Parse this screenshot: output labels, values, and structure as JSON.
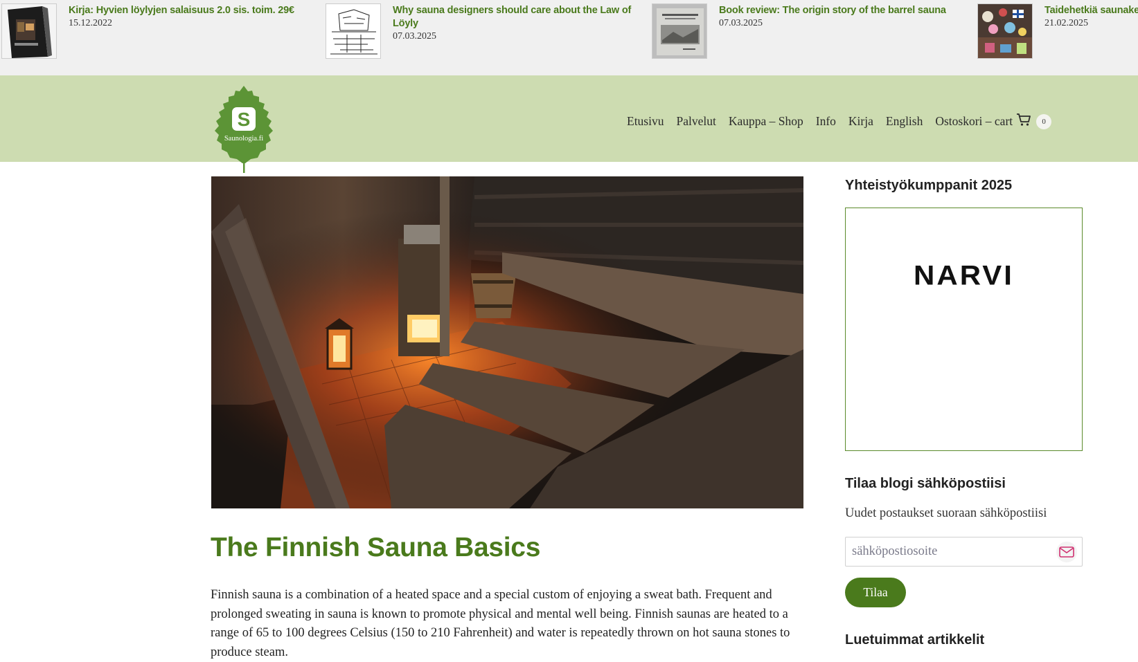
{
  "ticker": [
    {
      "title": "Kirja: Hyvien löylyjen salaisuus 2.0 sis. toim. 29€",
      "date": "15.12.2022",
      "thumb": "book-cover-thumbnail"
    },
    {
      "title": "Why sauna designers should care about the Law of Löyly",
      "date": "07.03.2025",
      "thumb": "sketch-drawing-thumbnail"
    },
    {
      "title": "Book review: The origin story of the barrel sauna",
      "date": "07.03.2025",
      "thumb": "book-cover-thumbnail"
    },
    {
      "title": "Taidehetkiä saunakeskustelu",
      "date": "21.02.2025",
      "thumb": "colorful-art-thumbnail"
    }
  ],
  "header": {
    "logo_letter": "S",
    "logo_text": "Saunologia.fi",
    "nav": [
      "Etusivu",
      "Palvelut",
      "Kauppa – Shop",
      "Info",
      "Kirja",
      "English"
    ],
    "cart_label": "Ostoskori – cart",
    "cart_count": "0",
    "colors": {
      "header_bg": "#cddcb1",
      "accent": "#4a7a1c"
    }
  },
  "main": {
    "hero_alt": "dim wooden sauna interior with glowing stove and lantern",
    "title": "The Finnish Sauna Basics",
    "body": "Finnish sauna is a combination of a heated space and a special custom of enjoying a sweat bath. Frequent and prolonged sweating in sauna is known to promote physical and mental well being. Finnish saunas are heated to a range of 65 to 100 degrees Celsius (150 to 210 Fahrenheit) and water is repeatedly thrown on hot sauna stones to produce steam."
  },
  "sidebar": {
    "partners_heading": "Yhteistyökumppanit 2025",
    "partner_logo": "NARVI",
    "subscribe_heading": "Tilaa blogi sähköpostiisi",
    "subscribe_text": "Uudet postaukset suoraan sähköpostiisi",
    "email_placeholder": "sähköpostiosoite",
    "subscribe_button": "Tilaa",
    "popular_heading": "Luetuimmat artikkelit"
  }
}
